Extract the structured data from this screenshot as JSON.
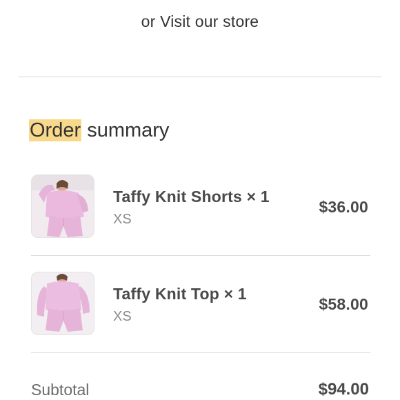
{
  "visit_store_text": "or Visit our store",
  "order_summary": {
    "title_highlight": "Order",
    "title_rest": " summary"
  },
  "items": [
    {
      "name": "Taffy Knit Shorts × 1",
      "variant": "XS",
      "price": "$36.00",
      "image_icon": "product-photo-pink-knit-set"
    },
    {
      "name": "Taffy Knit Top × 1",
      "variant": "XS",
      "price": "$58.00",
      "image_icon": "product-photo-pink-knit-set"
    }
  ],
  "subtotal": {
    "label": "Subtotal",
    "value": "$94.00"
  },
  "colors": {
    "highlight": "#f8d98b",
    "product_pink": "#e9b8dc"
  }
}
